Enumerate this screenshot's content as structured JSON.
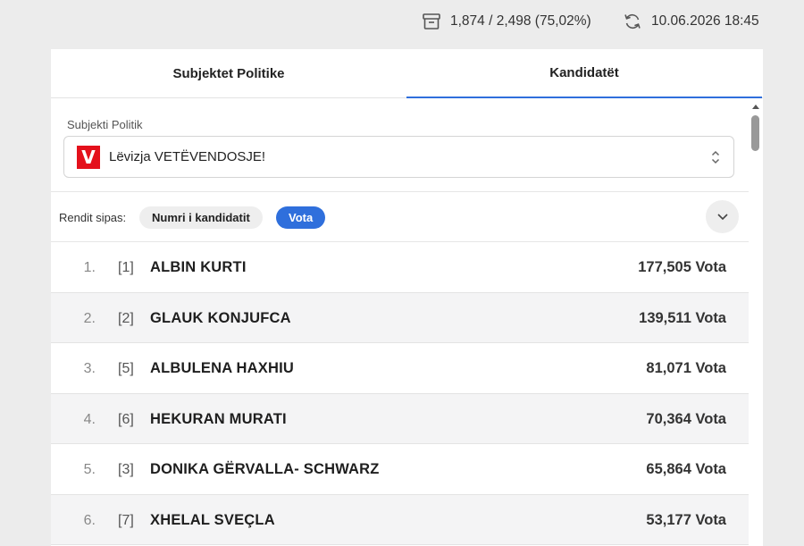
{
  "header": {
    "counted_text": "1,874 / 2,498 (75,02%)",
    "updated_text": "10.06.2026 18:45",
    "counted_icon": "ballot-box-icon",
    "updated_icon": "refresh-icon"
  },
  "tabs": [
    {
      "label": "Subjektet Politike",
      "active": false
    },
    {
      "label": "Kandidatët",
      "active": true
    }
  ],
  "filter": {
    "label": "Subjekti Politik",
    "selected": "Lëvizja VETËVENDOSJE!",
    "logo_letter": "V",
    "logo_color": "#e4101b"
  },
  "sort": {
    "label": "Rendit sipas:",
    "options": [
      {
        "label": "Numri i kandidatit",
        "active": false
      },
      {
        "label": "Vota",
        "active": true
      }
    ]
  },
  "candidates": [
    {
      "rank": "1.",
      "number": "[1]",
      "name": "ALBIN KURTI",
      "votes": "177,505 Vota"
    },
    {
      "rank": "2.",
      "number": "[2]",
      "name": "GLAUK KONJUFCA",
      "votes": "139,511 Vota"
    },
    {
      "rank": "3.",
      "number": "[5]",
      "name": "ALBULENA HAXHIU",
      "votes": "81,071 Vota"
    },
    {
      "rank": "4.",
      "number": "[6]",
      "name": "HEKURAN MURATI",
      "votes": "70,364 Vota"
    },
    {
      "rank": "5.",
      "number": "[3]",
      "name": "DONIKA GËRVALLA- SCHWARZ",
      "votes": "65,864 Vota"
    },
    {
      "rank": "6.",
      "number": "[7]",
      "name": "XHELAL SVEÇLA",
      "votes": "53,177 Vota"
    }
  ],
  "colors": {
    "accent": "#2f6fdc",
    "row_alt": "#f4f4f5",
    "page_bg": "#ececec"
  }
}
